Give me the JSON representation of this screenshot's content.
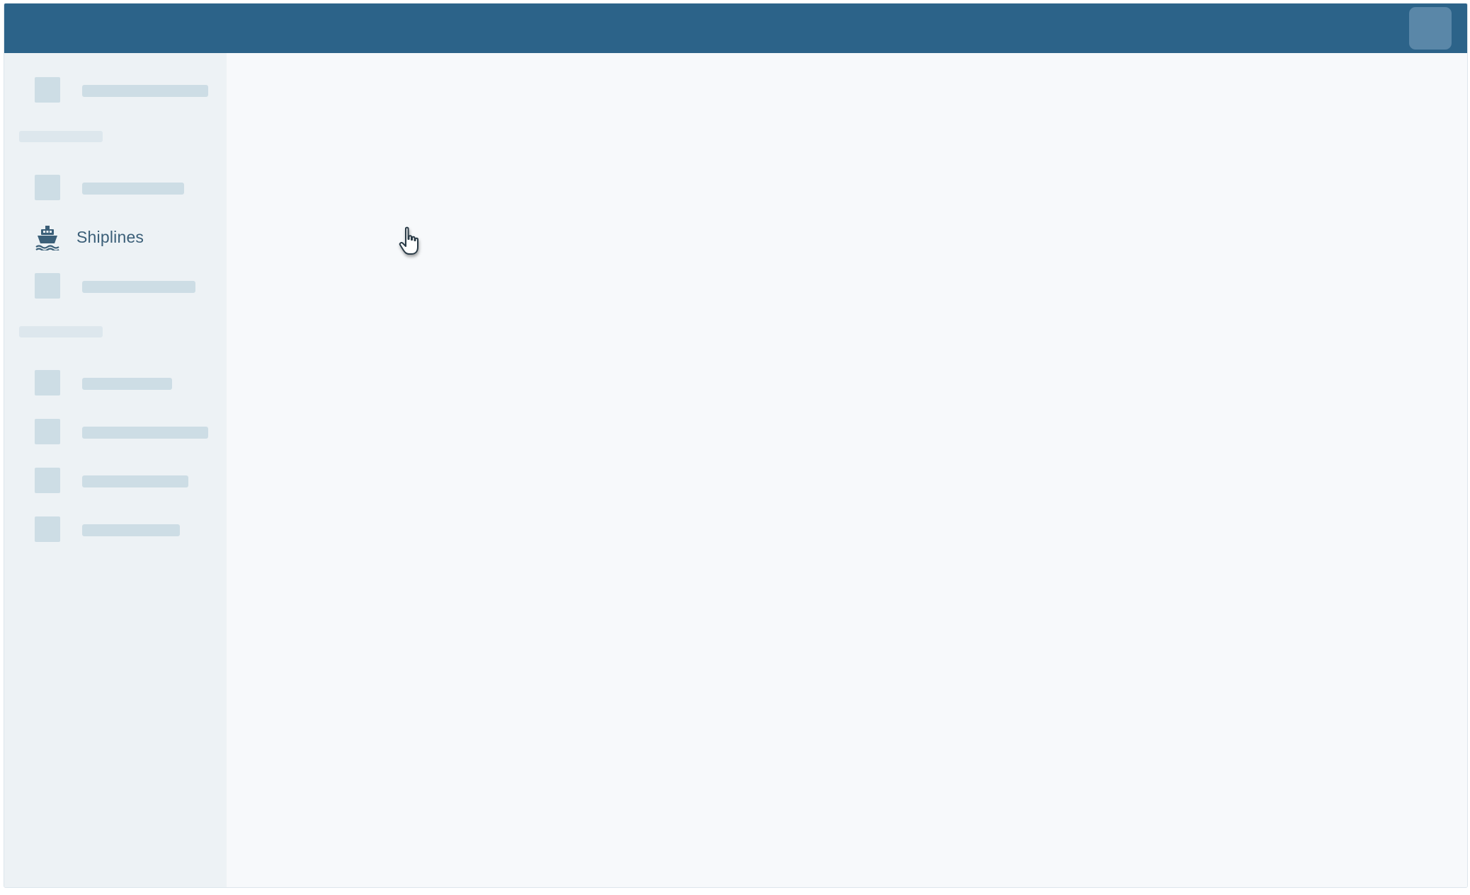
{
  "sidebar": {
    "active_item": {
      "label": "Shiplines",
      "icon": "ship-icon"
    }
  },
  "cursor": {
    "icon": "hand-pointer-icon"
  },
  "colors": {
    "top_bar": "#2c6389",
    "sidebar_bg": "#edf2f5",
    "content_bg": "#f7f9fb",
    "placeholder": "#cddde5",
    "active_text": "#3b5f78"
  }
}
